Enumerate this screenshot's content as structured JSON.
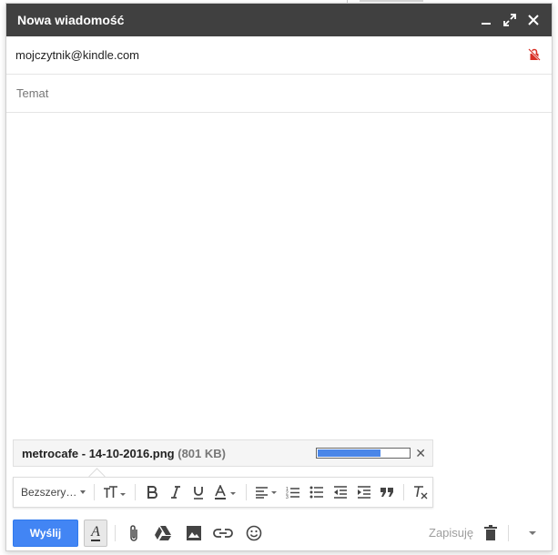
{
  "window": {
    "title": "Nowa wiadomość",
    "controls": [
      "minimize-icon",
      "popout-icon",
      "close-icon"
    ]
  },
  "recipient": {
    "address": "mojczytnik@kindle.com",
    "icon": "lock-off-icon",
    "icon_color": "#d93025"
  },
  "subject": {
    "placeholder": "Temat",
    "value": ""
  },
  "attachment": {
    "filename": "metrocafe - 14-10-2016.png",
    "size": "(801 KB)",
    "progress": 0.7,
    "progress_color": "#4a86e8"
  },
  "formatting_toolbar": {
    "font_label": "Bezszery…",
    "buttons": [
      "text-size-icon",
      "bold-icon",
      "italic-icon",
      "underline-icon",
      "text-color-icon",
      "align-icon",
      "numbered-list-icon",
      "bulleted-list-icon",
      "indent-less-icon",
      "indent-more-icon",
      "quote-icon",
      "remove-formatting-icon"
    ]
  },
  "bottom_toolbar": {
    "send_label": "Wyślij",
    "send_color": "#4285f4",
    "save_status": "Zapisuję",
    "icons": [
      "formatting-options-icon",
      "attach-file-icon",
      "insert-drive-icon",
      "insert-photo-icon",
      "insert-link-icon",
      "insert-emoji-icon",
      "discard-draft-icon",
      "more-options-icon"
    ]
  }
}
